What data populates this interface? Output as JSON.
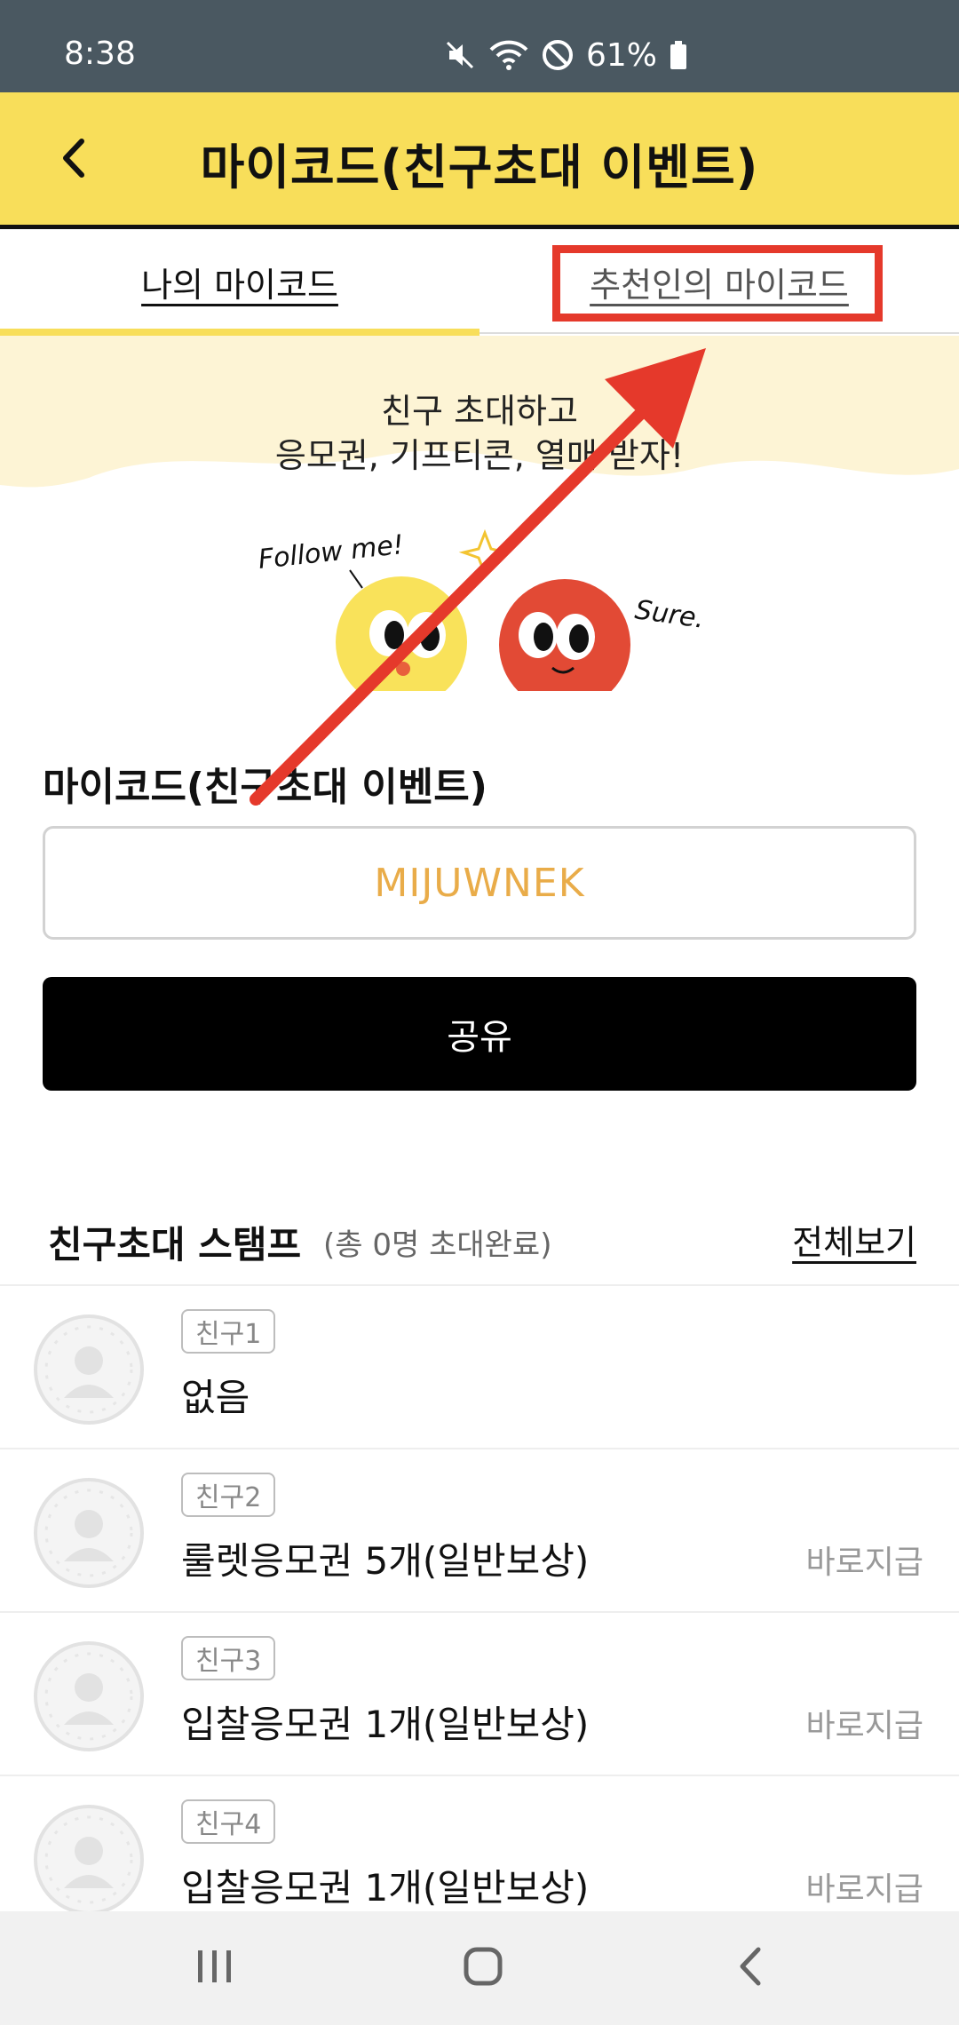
{
  "status_bar": {
    "time": "8:38",
    "battery": "61%",
    "icons": [
      "mute-icon",
      "wifi-icon",
      "do-not-disturb-icon",
      "battery-icon"
    ]
  },
  "header": {
    "title": "마이코드(친구초대 이벤트)",
    "back_icon": "chevron-left-icon"
  },
  "tabs": [
    {
      "label": "나의 마이코드",
      "active": true
    },
    {
      "label": "추천인의 마이코드",
      "active": false
    }
  ],
  "banner": {
    "line1": "친구 초대하고",
    "line2": "응모권, 기프티콘, 열매 받자!",
    "follow_text": "Follow me!",
    "sure_text": "Sure."
  },
  "code_section": {
    "label": "마이코드(친구초대 이벤트)",
    "code": "MIJUWNEK",
    "share_label": "공유"
  },
  "stamp_section": {
    "title": "친구초대 스탬프",
    "count": "(총 0명 초대완료)",
    "view_all": "전체보기"
  },
  "friends": [
    {
      "badge": "친구1",
      "reward": "없음",
      "status": ""
    },
    {
      "badge": "친구2",
      "reward": "룰렛응모권 5개(일반보상)",
      "status": "바로지급"
    },
    {
      "badge": "친구3",
      "reward": "입찰응모권 1개(일반보상)",
      "status": "바로지급"
    },
    {
      "badge": "친구4",
      "reward": "입찰응모권 1개(일반보상)",
      "status": "바로지급"
    }
  ],
  "colors": {
    "header_bg": "#f8de5a",
    "status_bar_bg": "#4a5861",
    "annotation_red": "#e5392b",
    "code_text": "#e9ac49"
  },
  "nav_bar": [
    "recents-icon",
    "home-icon",
    "back-icon"
  ]
}
